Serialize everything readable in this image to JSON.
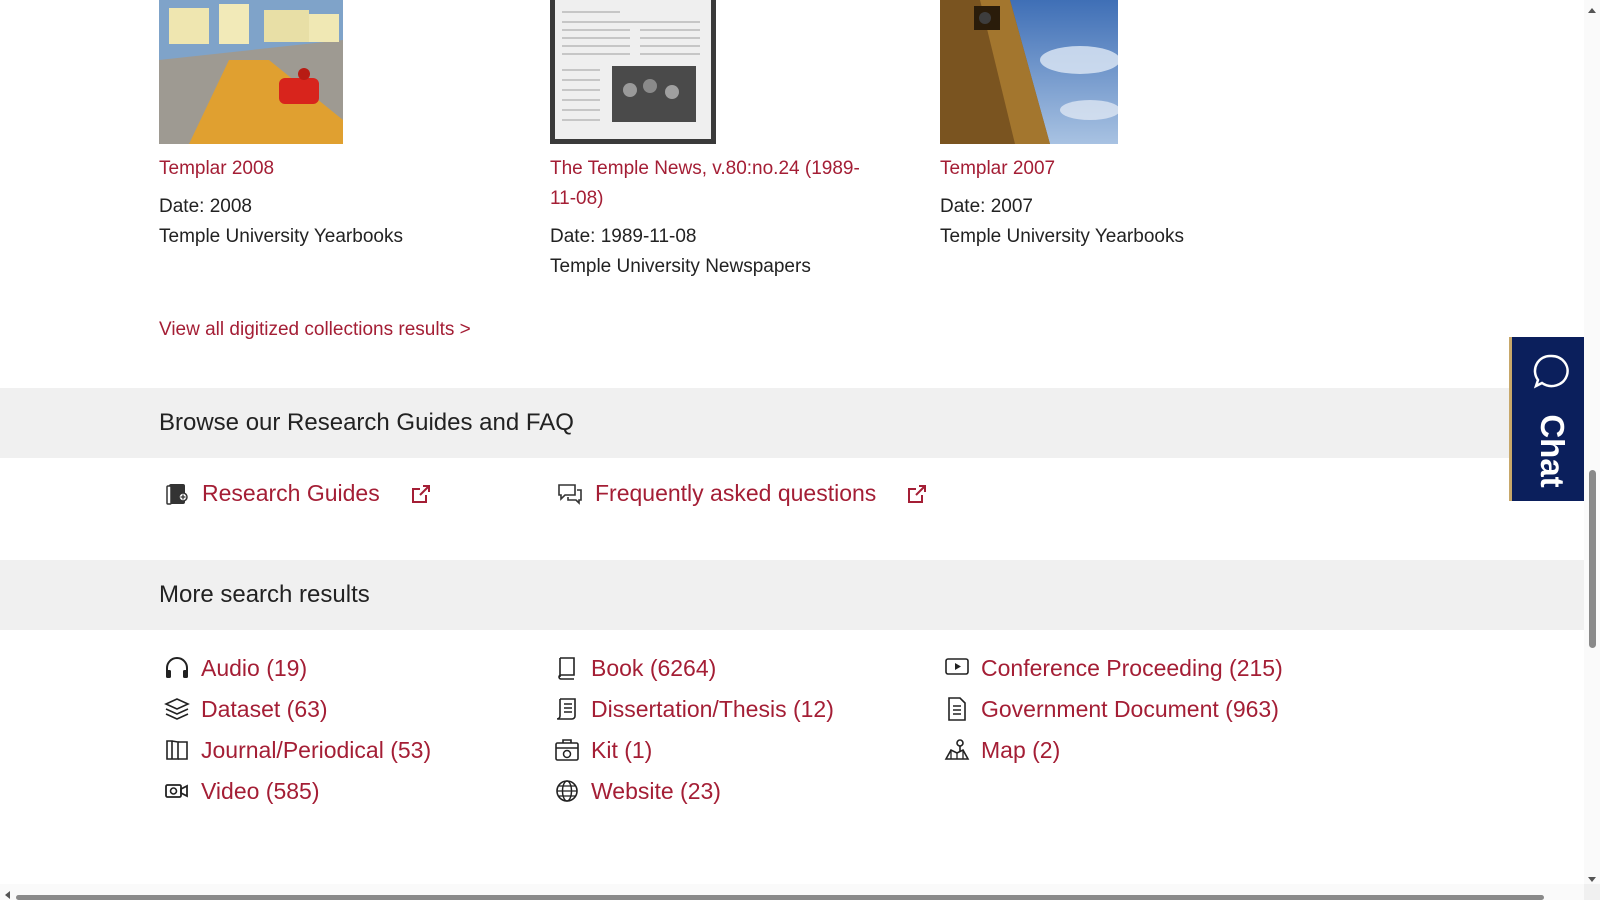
{
  "digitized": {
    "items": [
      {
        "title": "Templar 2008",
        "date_line": "Date: 2008",
        "collection": "Temple University Yearbooks"
      },
      {
        "title": "The Temple News, v.80:no.24 (1989-11-08)",
        "date_line": "Date: 1989-11-08",
        "collection": "Temple University Newspapers"
      },
      {
        "title": "Templar 2007",
        "date_line": "Date: 2007",
        "collection": "Temple University Yearbooks"
      }
    ],
    "view_all_label": "View all digitized collections results >"
  },
  "guides": {
    "heading": "Browse our Research Guides and FAQ",
    "links": [
      {
        "label": "Research Guides",
        "icon": "book-bookmark-icon"
      },
      {
        "label": "Frequently asked questions",
        "icon": "chat-bubbles-icon"
      }
    ]
  },
  "more_results": {
    "heading": "More search results",
    "items": [
      {
        "label": "Audio (19)",
        "icon": "headphones-icon"
      },
      {
        "label": "Book (6264)",
        "icon": "book-icon"
      },
      {
        "label": "Conference Proceeding (215)",
        "icon": "presentation-icon"
      },
      {
        "label": "Dataset (63)",
        "icon": "layers-icon"
      },
      {
        "label": "Dissertation/Thesis (12)",
        "icon": "scroll-icon"
      },
      {
        "label": "Government Document (963)",
        "icon": "document-icon"
      },
      {
        "label": "Journal/Periodical (53)",
        "icon": "journal-icon"
      },
      {
        "label": "Kit (1)",
        "icon": "kit-icon"
      },
      {
        "label": "Map (2)",
        "icon": "map-icon"
      },
      {
        "label": "Video (585)",
        "icon": "video-camera-icon"
      },
      {
        "label": "Website (23)",
        "icon": "globe-icon"
      }
    ]
  },
  "chat": {
    "label": "Chat"
  },
  "colors": {
    "link": "#a41e35",
    "chat_bg": "#0b1f5c",
    "band_bg": "#f0f0f0"
  }
}
